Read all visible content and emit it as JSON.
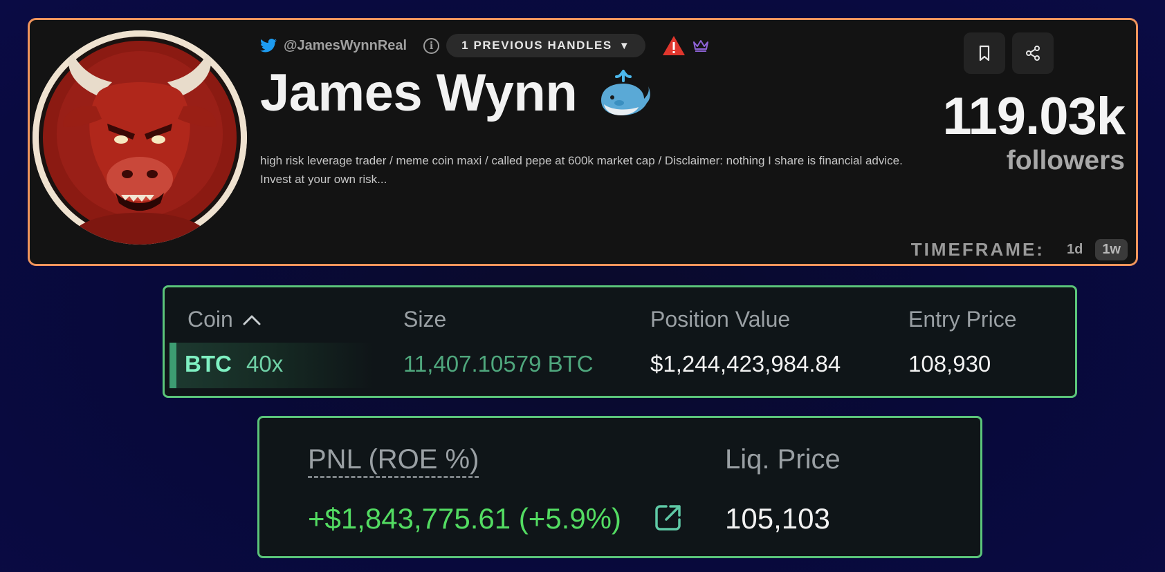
{
  "profile": {
    "handle": "@JamesWynnReal",
    "previous_handles_label": "1 PREVIOUS HANDLES",
    "display_name": "James Wynn",
    "bio": "high risk leverage trader / meme coin maxi / called pepe at 600k market cap / Disclaimer: nothing I share is financial advice. Invest at your own risk...",
    "followers_count": "119.03k",
    "followers_label": "followers",
    "timeframe_label": "TIMEFRAME:",
    "timeframe_options": [
      "1d",
      "1w"
    ],
    "timeframe_selected": "1w",
    "border_color": "#f0955c"
  },
  "positions": {
    "columns": [
      "Coin",
      "Size",
      "Position Value",
      "Entry Price"
    ],
    "rows": [
      {
        "coin": "BTC",
        "leverage": "40x",
        "size": "11,407.10579 BTC",
        "position_value": "$1,244,423,984.84",
        "entry_price": "108,930"
      }
    ],
    "border_color": "#5bc57a"
  },
  "pnl": {
    "pnl_label": "PNL (ROE %)",
    "liq_label": "Liq. Price",
    "pnl_value": "+$1,843,775.61 (+5.9%)",
    "liq_value": "105,103",
    "positive_color": "#53dc62"
  }
}
